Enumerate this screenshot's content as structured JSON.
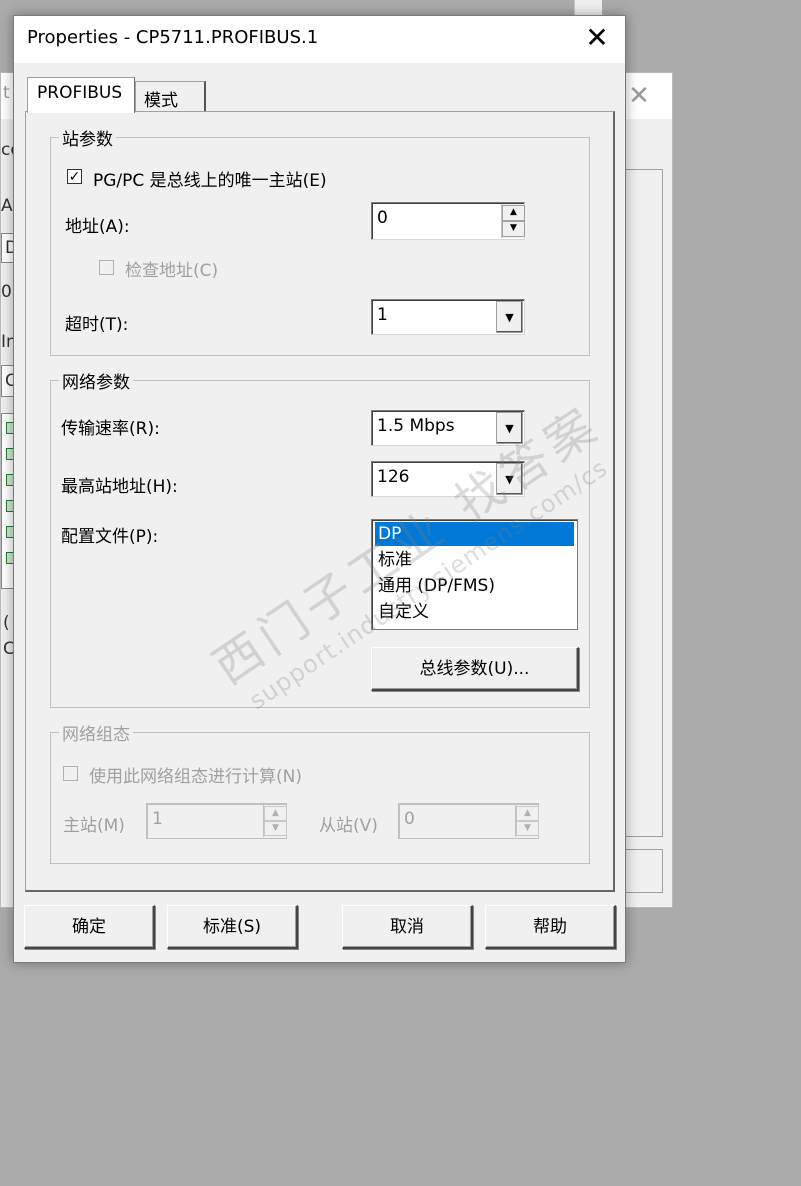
{
  "background_window": {
    "title_fragment": "t I",
    "left_fragments": [
      "co",
      "A",
      "D",
      "0",
      "In",
      "C",
      "(",
      "C"
    ]
  },
  "dialog": {
    "title": "Properties - CP5711.PROFIBUS.1",
    "close_glyph": "✕",
    "tabs": [
      {
        "label": "PROFIBUS",
        "active": true
      },
      {
        "label": "模式",
        "active": false
      }
    ]
  },
  "station_params": {
    "legend": "站参数",
    "only_master_label": "PG/PC 是总线上的唯一主站(E)",
    "only_master_checked": true,
    "address_label": "地址(A):",
    "address_value": "0",
    "check_address_label": "检查地址(C)",
    "check_address_checked": false,
    "timeout_label": "超时(T):",
    "timeout_value": "1"
  },
  "network_params": {
    "legend": "网络参数",
    "baud_label": "传输速率(R):",
    "baud_value": "1.5 Mbps",
    "hsa_label": "最高站地址(H):",
    "hsa_value": "126",
    "profile_label": "配置文件(P):",
    "profiles": [
      "DP",
      "标准",
      "通用 (DP/FMS)",
      "自定义"
    ],
    "selected_profile": "DP",
    "bus_params_button": "总线参数(U)..."
  },
  "network_config": {
    "legend": "网络组态",
    "use_config_label": "使用此网络组态进行计算(N)",
    "use_config_checked": false,
    "master_label": "主站(M)",
    "master_value": "1",
    "slave_label": "从站(V)",
    "slave_value": "0"
  },
  "buttons": {
    "ok": "确定",
    "default": "标准(S)",
    "cancel": "取消",
    "help": "帮助"
  },
  "watermark": {
    "line1": "西门子工业 找答案",
    "line2": "support.industry.siemens.com/cs"
  },
  "colors": {
    "desktop": "#ababab",
    "dialog_bg": "#f0f0f0",
    "selection": "#0078d7",
    "disabled_text": "#a0a0a0"
  }
}
